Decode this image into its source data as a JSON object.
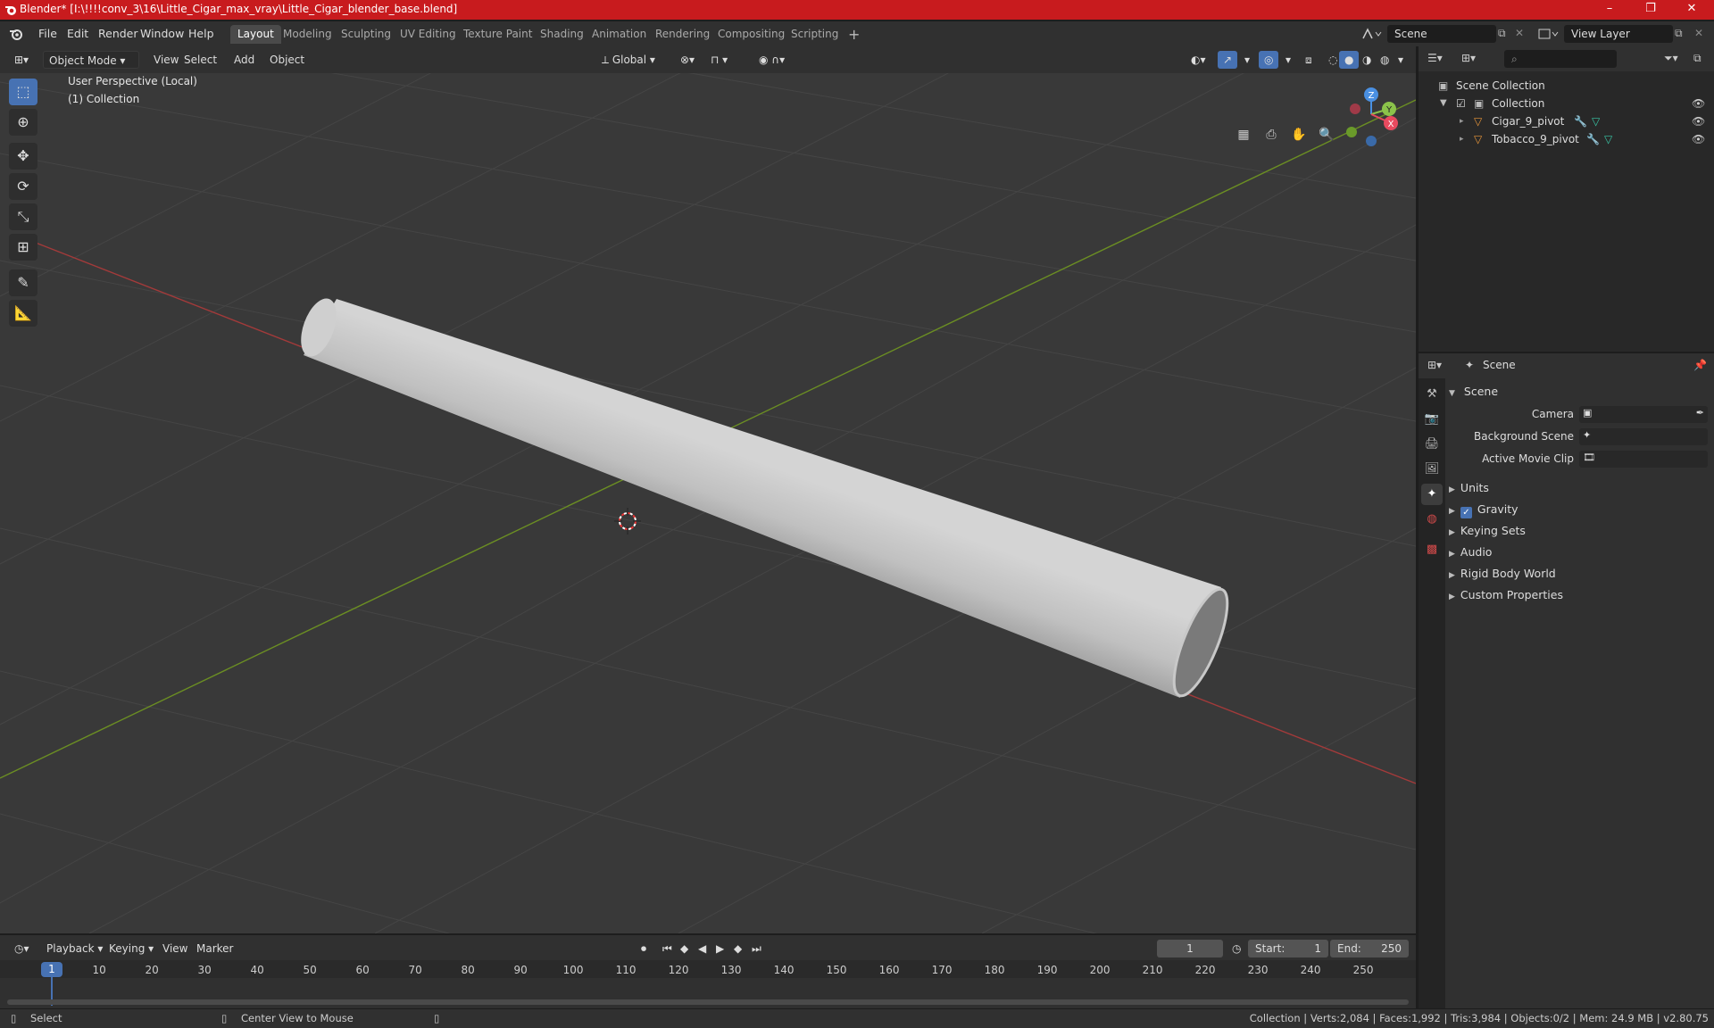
{
  "titlebar": {
    "title": "Blender* [I:\\!!!!conv_3\\16\\Little_Cigar_max_vray\\Little_Cigar_blender_base.blend]",
    "minimize": "–",
    "maximize": "❐",
    "close": "✕"
  },
  "menus": [
    "File",
    "Edit",
    "Render",
    "Window",
    "Help"
  ],
  "workspaces": [
    "Layout",
    "Modeling",
    "Sculpting",
    "UV Editing",
    "Texture Paint",
    "Shading",
    "Animation",
    "Rendering",
    "Compositing",
    "Scripting"
  ],
  "active_workspace": "Layout",
  "scene_field": "Scene",
  "view_layer_field": "View Layer",
  "viewport": {
    "mode": "Object Mode",
    "header_menus": [
      "View",
      "Select",
      "Add",
      "Object"
    ],
    "orientation": "Global",
    "info_line1": "User Perspective (Local)",
    "info_line2": "(1) Collection",
    "gizmo_labels": {
      "z": "Z",
      "y": "Y",
      "x": "X"
    }
  },
  "outliner": {
    "root": "Scene Collection",
    "collection": "Collection",
    "items": [
      "Cigar_9_pivot",
      "Tobacco_9_pivot"
    ]
  },
  "properties": {
    "context": "Scene",
    "panel": "Scene",
    "fields": [
      "Camera",
      "Background Scene",
      "Active Movie Clip"
    ],
    "subpanels": [
      "Units",
      "Gravity",
      "Keying Sets",
      "Audio",
      "Rigid Body World",
      "Custom Properties"
    ],
    "gravity_checked": true
  },
  "timeline": {
    "menus": [
      "Playback",
      "Keying",
      "View",
      "Marker"
    ],
    "current_frame": "1",
    "start_label": "Start:",
    "start_value": "1",
    "end_label": "End:",
    "end_value": "250",
    "ticks": [
      "1",
      "10",
      "20",
      "30",
      "40",
      "50",
      "60",
      "70",
      "80",
      "90",
      "100",
      "110",
      "120",
      "130",
      "140",
      "150",
      "160",
      "170",
      "180",
      "190",
      "200",
      "210",
      "220",
      "230",
      "240",
      "250"
    ]
  },
  "statusbar": {
    "left_action": "Select",
    "middle_action": "Center View to Mouse",
    "stats": "Collection | Verts:2,084 | Faces:1,992 | Tris:3,984 | Objects:0/2 | Mem: 24.9 MB | v2.80.75"
  },
  "colors": {
    "accent": "#4772b3",
    "titlebar": "#c81b1e",
    "x_axis": "#e84a5f",
    "y_axis": "#8bc34a",
    "z_axis": "#4a90e2"
  }
}
